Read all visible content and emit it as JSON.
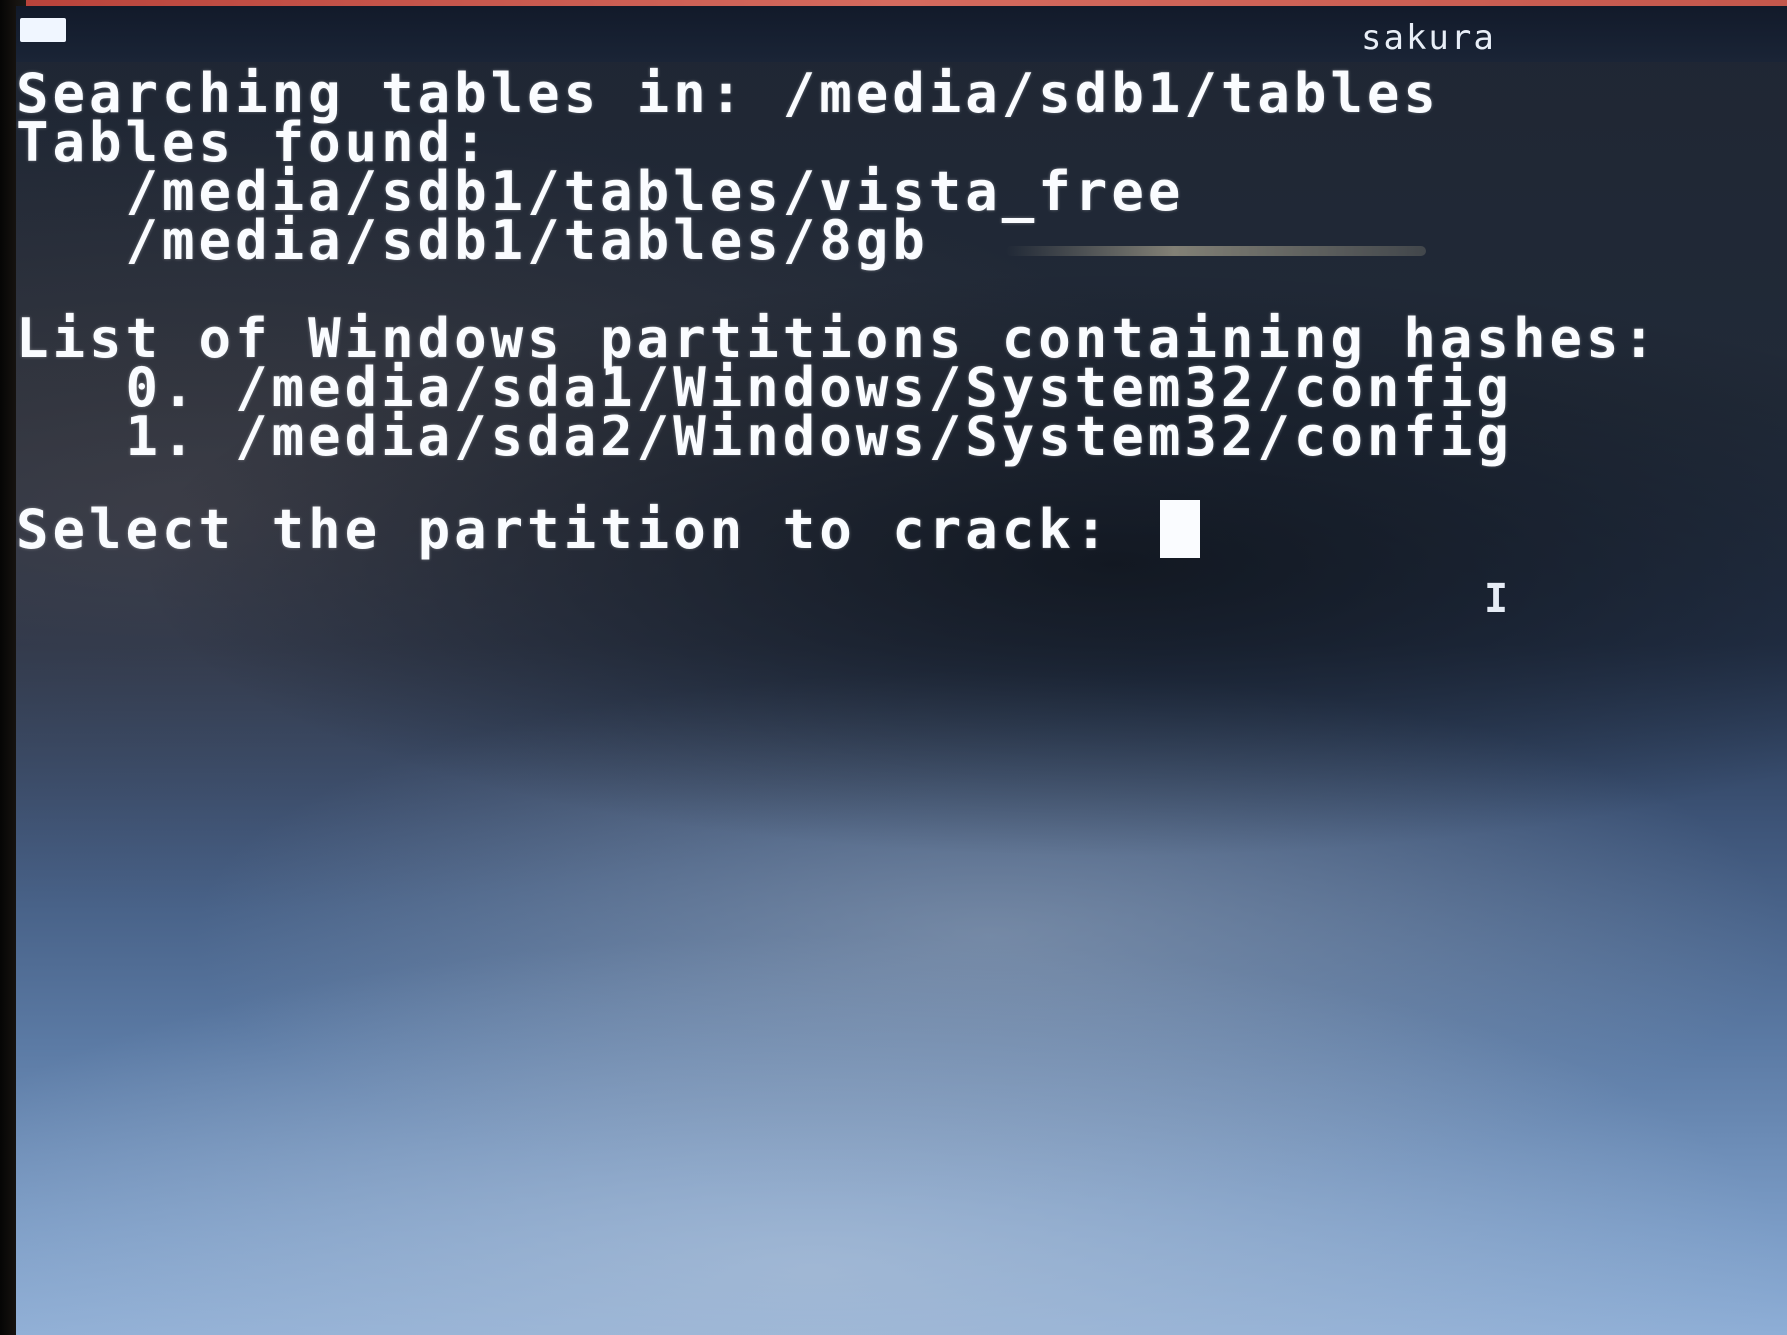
{
  "window": {
    "title": "sakura"
  },
  "terminal": {
    "lines": [
      "Searching tables in: /media/sdb1/tables",
      "Tables found:",
      "   /media/sdb1/tables/vista_free",
      "   /media/sdb1/tables/8gb",
      "",
      "List of Windows partitions containing hashes:",
      "   0. /media/sda1/Windows/System32/config",
      "   1. /media/sda2/Windows/System32/config",
      "",
      "Select the partition to crack: "
    ]
  },
  "colors": {
    "text": "#fafcff",
    "titlebar": "#121a2a",
    "background_top": "#1f2633",
    "background_bottom": "#8eaed6"
  },
  "icons": {
    "window_icon": "terminal-window-icon",
    "pointer": "i-beam-cursor-icon"
  }
}
